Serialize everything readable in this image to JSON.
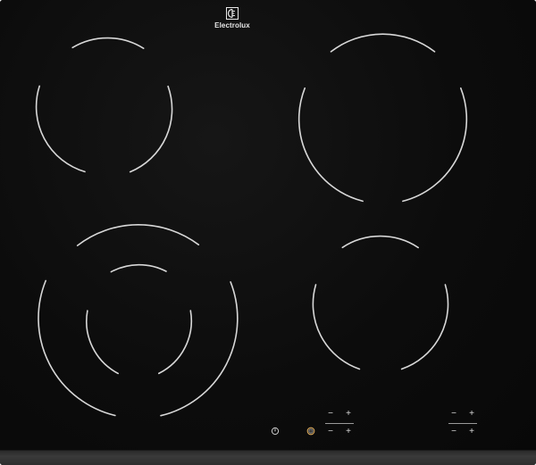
{
  "brand": {
    "name": "Electrolux",
    "logo_icon": "electrolux-logo"
  },
  "controls": {
    "minus_symbol": "−",
    "plus_symbol": "+",
    "power_icon": "power-icon",
    "lock_icon": "child-lock-icon"
  },
  "zones": [
    {
      "id": "front-left",
      "type": "dual-circuit"
    },
    {
      "id": "rear-left",
      "type": "single"
    },
    {
      "id": "rear-right",
      "type": "single-large"
    },
    {
      "id": "front-right",
      "type": "single"
    }
  ],
  "colors": {
    "glass": "#0b0b0b",
    "zone_outline": "#d8d8d8",
    "frame": "#333333"
  }
}
